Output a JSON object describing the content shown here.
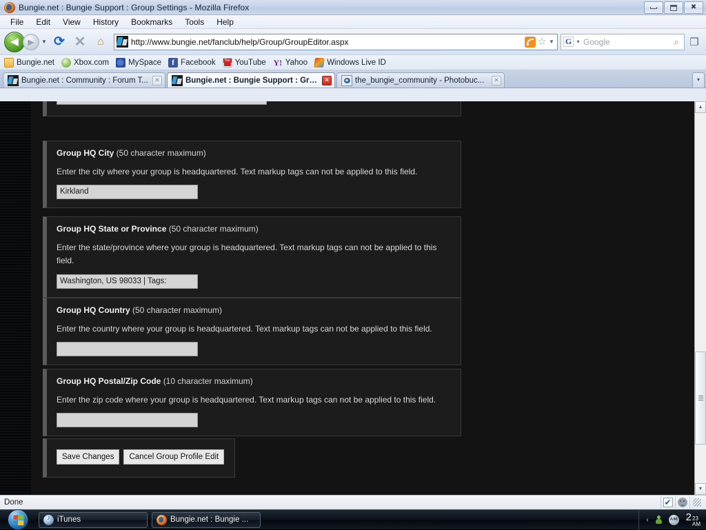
{
  "window": {
    "title": "Bungie.net : Bungie Support : Group Settings - Mozilla Firefox",
    "minimize_label": "Minimize",
    "maximize_label": "Restore",
    "close_label": "Close"
  },
  "menubar": [
    {
      "label": "File"
    },
    {
      "label": "Edit"
    },
    {
      "label": "View"
    },
    {
      "label": "History"
    },
    {
      "label": "Bookmarks"
    },
    {
      "label": "Tools"
    },
    {
      "label": "Help"
    }
  ],
  "toolbar": {
    "back_glyph": "◀",
    "forward_glyph": "▶",
    "history_dropdown_glyph": "▼",
    "reload_glyph": "⟳",
    "stop_glyph": "✕",
    "home_glyph": "⌂",
    "url": "http://www.bungie.net/fanclub/help/Group/GroupEditor.aspx",
    "url_dropdown_glyph": "▼",
    "star_glyph": "☆",
    "search_engine_letter": "G",
    "search_engine_dropdown_glyph": "▾",
    "search_placeholder": "Google",
    "search_glyph": "⌕",
    "tabgroups_glyph": "❐"
  },
  "bookmarks": [
    {
      "label": "Bungie.net",
      "icon": "folder-icon",
      "kind": "folder"
    },
    {
      "label": "Xbox.com",
      "icon": "xbox-icon",
      "kind": "xbox"
    },
    {
      "label": "MySpace",
      "icon": "myspace-icon",
      "kind": "myspace"
    },
    {
      "label": "Facebook",
      "icon": "facebook-icon",
      "kind": "fb",
      "glyph": "f"
    },
    {
      "label": "YouTube",
      "icon": "youtube-icon",
      "kind": "yt"
    },
    {
      "label": "Yahoo",
      "icon": "yahoo-icon",
      "kind": "yahoo",
      "glyph": "Y!"
    },
    {
      "label": "Windows Live ID",
      "icon": "windows-live-icon",
      "kind": "wlive"
    }
  ],
  "tabs": [
    {
      "label": "Bungie.net : Community : Forum T...",
      "active": false,
      "icon": "bungie-favicon",
      "close_glyph": "✕"
    },
    {
      "label": "Bungie.net : Bungie Support : Gro...",
      "active": true,
      "icon": "bungie-favicon",
      "close_glyph": "✕"
    },
    {
      "label": "the_bungie_community - Photobuc...",
      "active": false,
      "icon": "photobucket-favicon",
      "close_glyph": "✕"
    }
  ],
  "tablist_dropdown_glyph": "▾",
  "page": {
    "fields": [
      {
        "title_bold": "Group HQ City",
        "title_note": "(50 character maximum)",
        "description": "Enter the city where your group is headquartered. Text markup tags can not be applied to this field.",
        "value": "Kirkland",
        "placeholder": ""
      },
      {
        "title_bold": "Group HQ State or Province",
        "title_note": "(50 character maximum)",
        "description": "Enter the state/province where your group is headquartered. Text markup tags can not be applied to this field.",
        "value": "Washington, US 98033 | Tags:",
        "placeholder": ""
      },
      {
        "title_bold": "Group HQ Country",
        "title_note": "(50 character maximum)",
        "description": "Enter the country where your group is headquartered. Text markup tags can not be applied to this field.",
        "value": "",
        "placeholder": ""
      },
      {
        "title_bold": "Group HQ Postal/Zip Code",
        "title_note": "(10 character maximum)",
        "description": "Enter the zip code where your group is headquartered. Text markup tags can not be applied to this field.",
        "value": "",
        "placeholder": ""
      }
    ],
    "buttons": {
      "save": "Save Changes",
      "cancel": "Cancel Group Profile Edit"
    },
    "scrollbar": {
      "up_glyph": "▲",
      "down_glyph": "▼"
    }
  },
  "statusbar": {
    "text": "Done"
  },
  "taskbar": {
    "start_label": "Start",
    "items": [
      {
        "label": "iTunes",
        "icon": "itunes-icon",
        "kind": "itunes"
      },
      {
        "label": "Bungie.net : Bungie ...",
        "icon": "firefox-icon",
        "kind": "ff"
      }
    ],
    "tray": {
      "expand_glyph": "‹",
      "aim_label": "AIM",
      "clock_hour": "2",
      "clock_minute": "23",
      "clock_meridiem": "AM"
    }
  }
}
